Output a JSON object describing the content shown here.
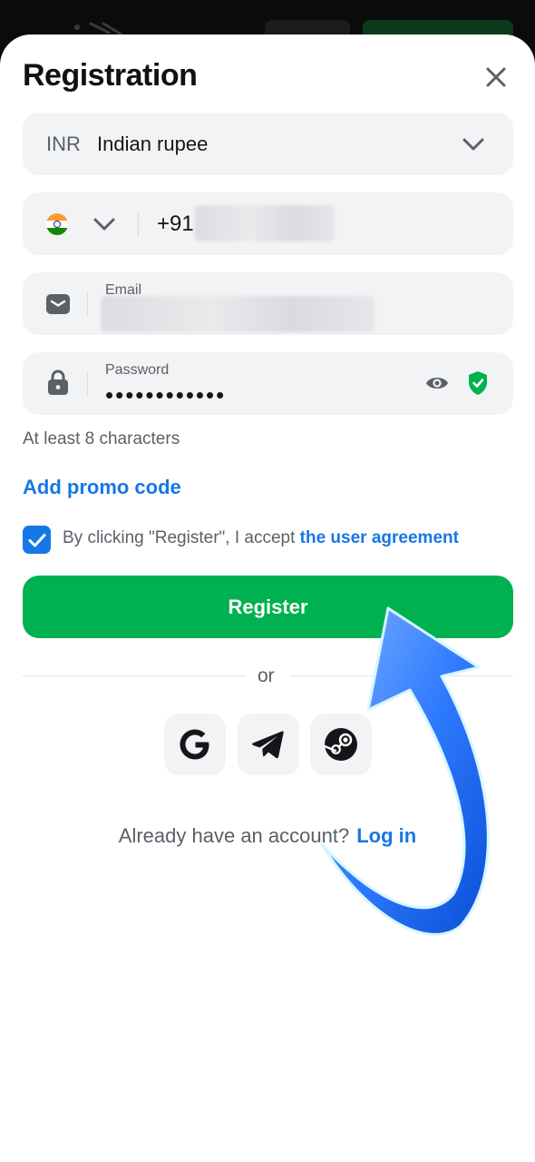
{
  "header": {
    "title": "Registration"
  },
  "currency": {
    "code": "INR",
    "name": "Indian rupee"
  },
  "phone": {
    "prefix": "+91"
  },
  "email": {
    "label": "Email"
  },
  "password": {
    "label": "Password",
    "value": "••••••••••••",
    "hint": "At least 8 characters"
  },
  "promo": {
    "label": "Add promo code"
  },
  "agreement": {
    "text": "By clicking \"Register\", I accept",
    "link": "the user agreement",
    "checked": true
  },
  "register_button": {
    "label": "Register"
  },
  "divider": {
    "label": "or"
  },
  "social": [
    {
      "name": "google-icon"
    },
    {
      "name": "telegram-icon"
    },
    {
      "name": "steam-icon"
    }
  ],
  "login_prompt": {
    "text": "Already have an account?",
    "link": "Log in"
  },
  "colors": {
    "accent": "#1677e6",
    "register": "#00b14f",
    "field_bg": "#f2f3f5",
    "annotation_arrow": "#2f7bff"
  }
}
